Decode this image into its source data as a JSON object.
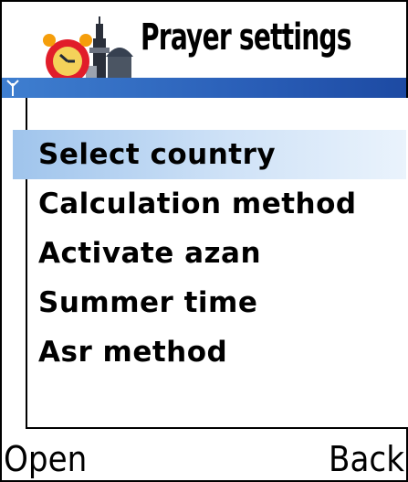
{
  "header": {
    "title": "Prayer settings",
    "icon": "alarm-clock-mosque-icon"
  },
  "status": {
    "signal_icon": "signal-antenna-icon"
  },
  "menu": {
    "items": [
      {
        "label": "Select country",
        "selected": true
      },
      {
        "label": "Calculation method",
        "selected": false
      },
      {
        "label": "Activate azan",
        "selected": false
      },
      {
        "label": "Summer time",
        "selected": false
      },
      {
        "label": "Asr method",
        "selected": false
      }
    ]
  },
  "softkeys": {
    "left": "Open",
    "right": "Back"
  },
  "colors": {
    "strip": "#2a5fb8",
    "selection": "#b9d5f2"
  }
}
